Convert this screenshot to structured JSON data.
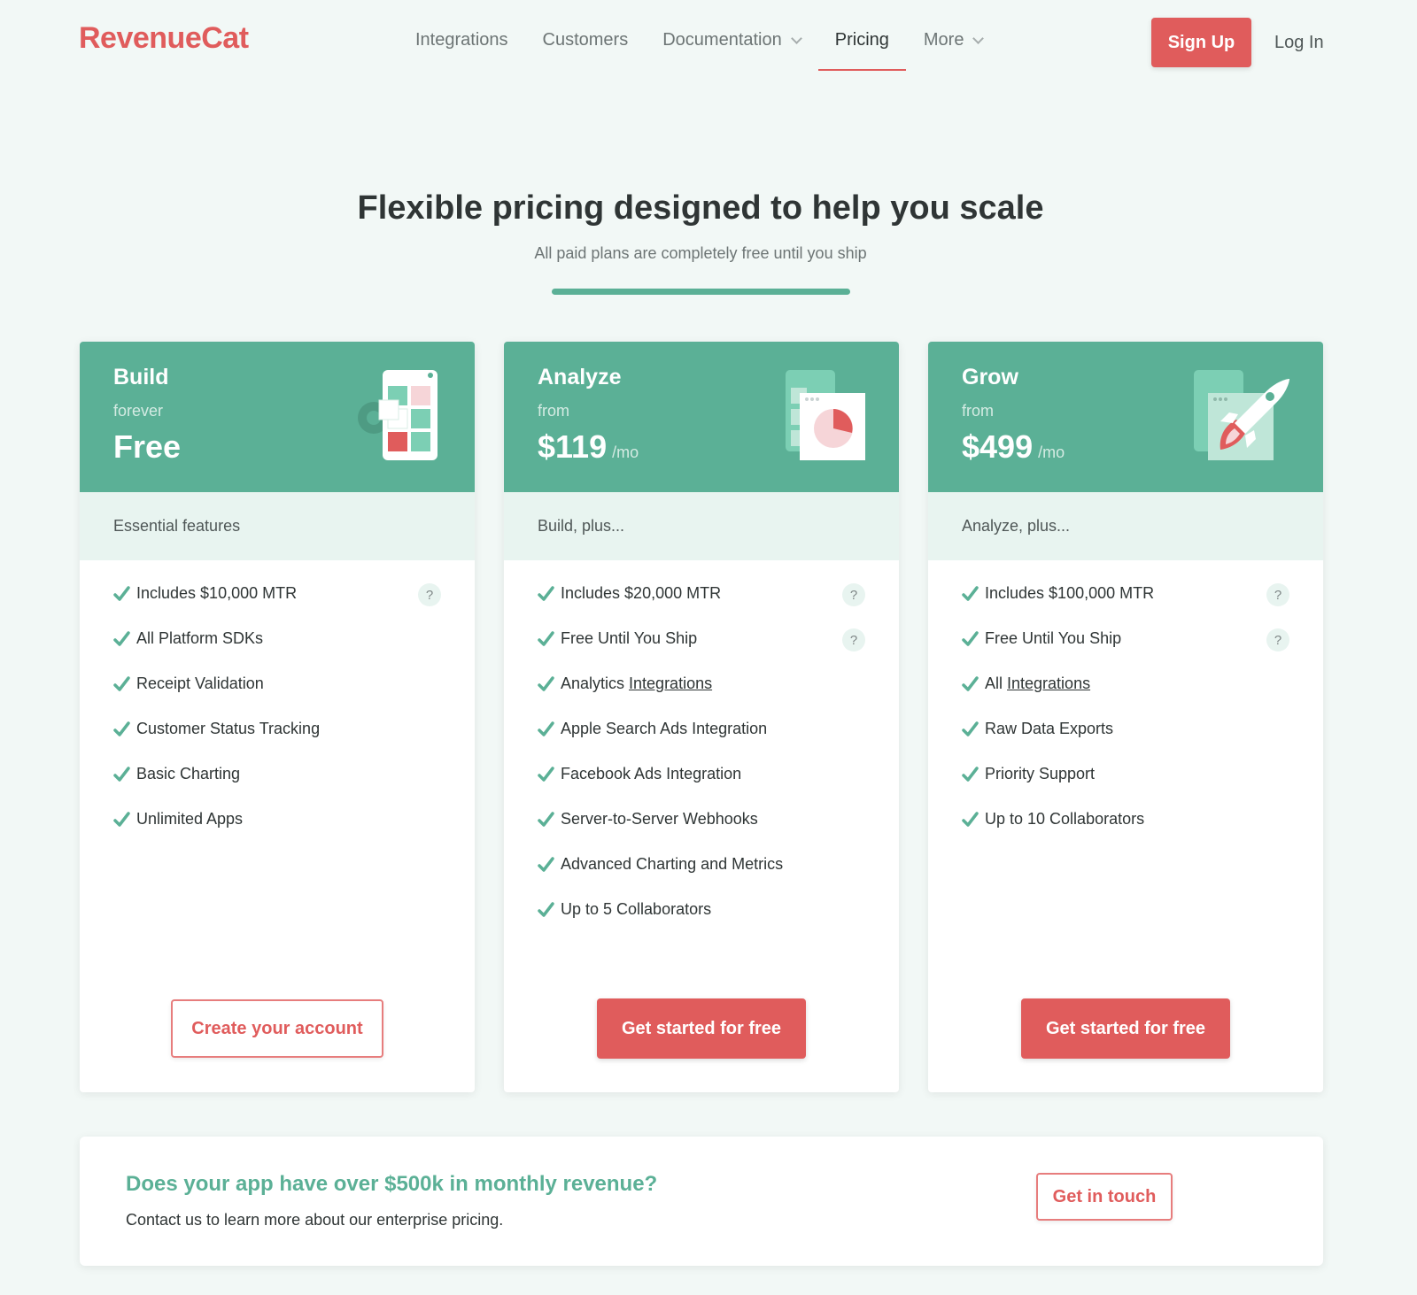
{
  "nav": {
    "logo": "RevenueCat",
    "links": [
      {
        "label": "Integrations"
      },
      {
        "label": "Customers"
      },
      {
        "label": "Documentation"
      },
      {
        "label": "Pricing"
      },
      {
        "label": "More"
      }
    ],
    "signup": "Sign Up",
    "login": "Log In"
  },
  "hero": {
    "title": "Flexible pricing designed to help you scale",
    "subtitle": "All paid plans are completely free until you ship"
  },
  "plans": [
    {
      "name": "Build",
      "qualifier": "forever",
      "price": "Free",
      "per": "",
      "subheader": "Essential features",
      "features": [
        {
          "text": "Includes $10,000 MTR",
          "help": "?"
        },
        {
          "text": "All Platform SDKs"
        },
        {
          "text": "Receipt Validation"
        },
        {
          "text": "Customer Status Tracking"
        },
        {
          "text": "Basic Charting"
        },
        {
          "text": "Unlimited Apps"
        }
      ],
      "cta": "Create your account"
    },
    {
      "name": "Analyze",
      "qualifier": "from",
      "price": "$119",
      "per": "/mo",
      "subheader": "Build, plus...",
      "features": [
        {
          "text": "Includes $20,000 MTR",
          "help": "?"
        },
        {
          "text": "Free Until You Ship",
          "help": "?"
        },
        {
          "text": "Analytics",
          "link": "Integrations"
        },
        {
          "text": "Apple Search Ads Integration"
        },
        {
          "text": "Facebook Ads Integration"
        },
        {
          "text": "Server-to-Server Webhooks"
        },
        {
          "text": "Advanced Charting and Metrics"
        },
        {
          "text": "Up to 5 Collaborators"
        }
      ],
      "cta": "Get started for free"
    },
    {
      "name": "Grow",
      "qualifier": "from",
      "price": "$499",
      "per": "/mo",
      "subheader": "Analyze, plus...",
      "features": [
        {
          "text": "Includes $100,000 MTR",
          "help": "?"
        },
        {
          "text": "Free Until You Ship",
          "help": "?"
        },
        {
          "text": "All",
          "link": "Integrations"
        },
        {
          "text": "Raw Data Exports"
        },
        {
          "text": "Priority Support"
        },
        {
          "text": "Up to 10 Collaborators"
        }
      ],
      "cta": "Get started for free"
    }
  ],
  "enterprise": {
    "title": "Does your app have over $500k in monthly revenue?",
    "text": "Contact us to learn more about our enterprise pricing.",
    "cta": "Get in touch"
  },
  "colors": {
    "brand": "#e05c5c",
    "accent": "#5bb096",
    "background": "#f2f8f6"
  }
}
